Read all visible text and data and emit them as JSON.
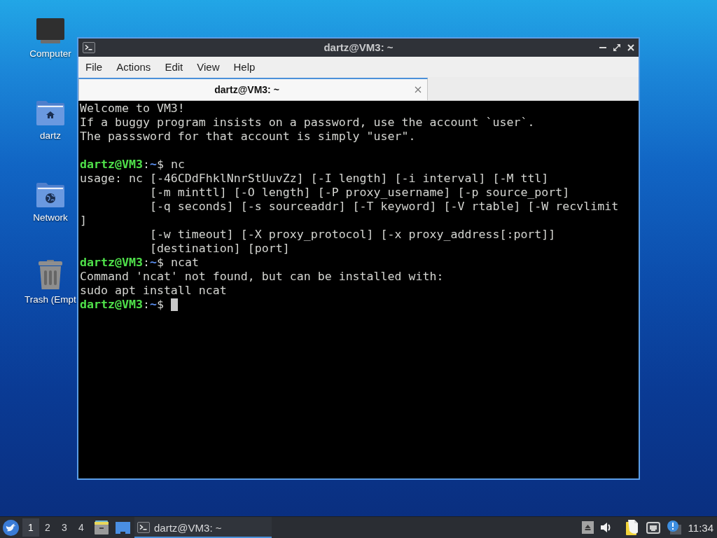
{
  "desktop_icons": [
    {
      "kind": "computer",
      "label": "Computer"
    },
    {
      "kind": "home",
      "label": "dartz"
    },
    {
      "kind": "network",
      "label": "Network"
    },
    {
      "kind": "trash",
      "label": "Trash (Empt"
    }
  ],
  "window": {
    "title": "dartz@VM3: ~",
    "menu": [
      "File",
      "Actions",
      "Edit",
      "View",
      "Help"
    ],
    "tabs": [
      {
        "label": "dartz@VM3: ~",
        "selected": true
      }
    ],
    "terminal": {
      "lines": [
        {
          "kind": "output",
          "text": "Welcome to VM3!"
        },
        {
          "kind": "output",
          "text": "If a buggy program insists on a password, use the account `user`."
        },
        {
          "kind": "output",
          "text": "The passsword for that account is simply \"user\"."
        },
        {
          "kind": "blank"
        },
        {
          "kind": "prompt",
          "user_host": "dartz@VM3",
          "colon": ":",
          "path": "~",
          "dollar": "$",
          "command": "nc",
          "cursor": false
        },
        {
          "kind": "output",
          "text": "usage: nc [-46CDdFhklNnrStUuvZz] [-I length] [-i interval] [-M ttl]"
        },
        {
          "kind": "continuation",
          "text": "[-m minttl] [-O length] [-P proxy_username] [-p source_port]"
        },
        {
          "kind": "continuation",
          "text": "[-q seconds] [-s sourceaddr] [-T keyword] [-V rtable] [-W recvlimit"
        },
        {
          "kind": "output",
          "text": "]"
        },
        {
          "kind": "continuation",
          "text": "[-w timeout] [-X proxy_protocol] [-x proxy_address[:port]]"
        },
        {
          "kind": "continuation",
          "text": "[destination] [port]"
        },
        {
          "kind": "prompt",
          "user_host": "dartz@VM3",
          "colon": ":",
          "path": "~",
          "dollar": "$",
          "command": "ncat",
          "cursor": false
        },
        {
          "kind": "output",
          "text": "Command 'ncat' not found, but can be installed with:"
        },
        {
          "kind": "output",
          "text": "sudo apt install ncat"
        },
        {
          "kind": "prompt",
          "user_host": "dartz@VM3",
          "colon": ":",
          "path": "~",
          "dollar": "$",
          "cursor": true
        }
      ]
    }
  },
  "taskbar": {
    "workspaces": [
      {
        "label": "1",
        "selected": true
      },
      {
        "label": "2",
        "selected": false
      },
      {
        "label": "3",
        "selected": false
      },
      {
        "label": "4",
        "selected": false
      }
    ],
    "tasks": [
      {
        "label": "dartz@VM3: ~",
        "selected": true
      }
    ],
    "clock": "11:34"
  }
}
